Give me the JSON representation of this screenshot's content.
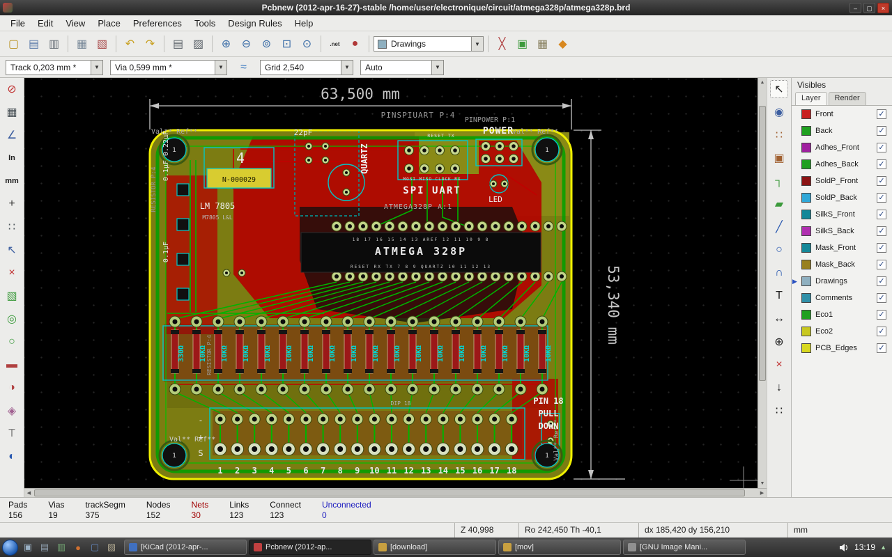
{
  "window": {
    "title": "Pcbnew (2012-apr-16-27)-stable /home/user/electronique/circuit/atmega328p/atmega328p.brd",
    "minimize": "–",
    "maximize": "▢",
    "close": "×"
  },
  "menubar": {
    "items": [
      "File",
      "Edit",
      "View",
      "Place",
      "Preferences",
      "Tools",
      "Design Rules",
      "Help"
    ]
  },
  "toolbar_main": {
    "icons_left": [
      {
        "name": "new-board-icon",
        "glyph": "▢",
        "color": "#b89020"
      },
      {
        "name": "open-board-icon",
        "glyph": "▤",
        "color": "#5878a8"
      },
      {
        "name": "save-board-icon",
        "glyph": "▥",
        "color": "#687078"
      },
      {
        "name": "page-settings-icon",
        "glyph": "▦",
        "color": "#788898"
      },
      {
        "name": "print-preview-icon",
        "glyph": "▧",
        "color": "#a84848"
      },
      {
        "name": "undo-icon",
        "glyph": "↶",
        "color": "#c8a020"
      },
      {
        "name": "redo-icon",
        "glyph": "↷",
        "color": "#c8a020"
      },
      {
        "name": "print-icon",
        "glyph": "▤",
        "color": "#585f66"
      },
      {
        "name": "plot-icon",
        "glyph": "▨",
        "color": "#585f66"
      },
      {
        "name": "zoom-in-icon",
        "glyph": "⊕",
        "color": "#3c6ea8"
      },
      {
        "name": "zoom-out-icon",
        "glyph": "⊖",
        "color": "#3c6ea8"
      },
      {
        "name": "zoom-redraw-icon",
        "glyph": "⊚",
        "color": "#3c6ea8"
      },
      {
        "name": "zoom-fit-icon",
        "glyph": "⊡",
        "color": "#3c6ea8"
      },
      {
        "name": "find-icon",
        "glyph": "⊙",
        "color": "#3c6ea8"
      },
      {
        "name": "netlist-icon",
        "glyph": ".net",
        "color": "#303030"
      },
      {
        "name": "drc-check-icon",
        "glyph": "●",
        "color": "#b03838"
      }
    ],
    "layer_combo": {
      "value": "Drawings",
      "swatch": "#8fb0c0",
      "arrow": "▼"
    },
    "icons_right": [
      {
        "name": "microwave-tools-icon",
        "glyph": "╳",
        "color": "#b04040"
      },
      {
        "name": "module-mode-icon",
        "glyph": "▣",
        "color": "#3c9a3c"
      },
      {
        "name": "ratsnest-mode-icon",
        "glyph": "▦",
        "color": "#888060"
      },
      {
        "name": "freeroute-icon",
        "glyph": "◆",
        "color": "#d88820"
      }
    ]
  },
  "toolbar_options": {
    "track": {
      "value": "Track 0,203 mm *",
      "arrow": "▼"
    },
    "via": {
      "value": "Via 0,599 mm *",
      "arrow": "▼"
    },
    "width_icon": {
      "name": "auto-track-width-icon",
      "glyph": "≈",
      "color": "#3878c0"
    },
    "grid": {
      "value": "Grid 2,540",
      "arrow": "▼"
    },
    "zoom": {
      "value": "Auto",
      "arrow": "▼"
    }
  },
  "left_toolbar": {
    "icons": [
      {
        "name": "drc-off-icon",
        "glyph": "⊘",
        "color": "#c03030"
      },
      {
        "name": "grid-visibility-icon",
        "glyph": "▦",
        "color": "#4a5258"
      },
      {
        "name": "polar-coords-icon",
        "glyph": "∠",
        "color": "#3c5ea0"
      },
      {
        "name": "units-inch-icon",
        "glyph": "In",
        "color": "#202020"
      },
      {
        "name": "units-mm-icon",
        "glyph": "mm",
        "color": "#202020"
      },
      {
        "name": "cursor-shape-icon",
        "glyph": "+",
        "color": "#303030"
      },
      {
        "name": "ratsnest-general-icon",
        "glyph": "∷",
        "color": "#4a5258"
      },
      {
        "name": "ratsnest-module-icon",
        "glyph": "↖",
        "color": "#3c5ea0"
      },
      {
        "name": "autodel-track-icon",
        "glyph": "×",
        "color": "#c03030"
      },
      {
        "name": "show-zones-icon",
        "glyph": "▧",
        "color": "#3c9a3c"
      },
      {
        "name": "sketch-pads-icon",
        "glyph": "◎",
        "color": "#3c9a3c"
      },
      {
        "name": "sketch-vias-icon",
        "glyph": "○",
        "color": "#3c9a3c"
      },
      {
        "name": "sketch-tracks-icon",
        "glyph": "▬",
        "color": "#b04040"
      },
      {
        "name": "high-contrast-icon",
        "glyph": "◑",
        "color": "#b04040"
      },
      {
        "name": "palette-icon",
        "glyph": "◈",
        "color": "#a06090"
      },
      {
        "name": "invisible-text-icon",
        "glyph": "T",
        "color": "#808080"
      },
      {
        "name": "contrast-display-icon",
        "glyph": "◐",
        "color": "#2858b0"
      }
    ]
  },
  "right_toolbar": {
    "icons": [
      {
        "name": "select-tool-icon",
        "glyph": "↖",
        "color": "#202020",
        "active": true
      },
      {
        "name": "highlight-net-icon",
        "glyph": "◉",
        "color": "#3c5ea0"
      },
      {
        "name": "local-ratsnest-icon",
        "glyph": "∷",
        "color": "#a06030"
      },
      {
        "name": "add-module-icon",
        "glyph": "▣",
        "color": "#a06030"
      },
      {
        "name": "add-track-icon",
        "glyph": "┐",
        "color": "#3c9a3c"
      },
      {
        "name": "add-zone-icon",
        "glyph": "▰",
        "color": "#3c9a3c"
      },
      {
        "name": "add-line-icon",
        "glyph": "╱",
        "color": "#2858b0"
      },
      {
        "name": "add-circle-icon",
        "glyph": "○",
        "color": "#2858b0"
      },
      {
        "name": "add-arc-icon",
        "glyph": "∩",
        "color": "#2858b0"
      },
      {
        "name": "add-text-icon",
        "glyph": "T",
        "color": "#202020"
      },
      {
        "name": "add-dimension-icon",
        "glyph": "↔",
        "color": "#202020"
      },
      {
        "name": "add-target-icon",
        "glyph": "⊕",
        "color": "#202020"
      },
      {
        "name": "delete-tool-icon",
        "glyph": "×",
        "color": "#c03030"
      },
      {
        "name": "offset-origin-icon",
        "glyph": "↓",
        "color": "#202020"
      },
      {
        "name": "grid-origin-icon",
        "glyph": "∷",
        "color": "#202020"
      }
    ]
  },
  "visibles": {
    "title": "Visibles",
    "tabs": [
      {
        "label": "Layer",
        "active": true
      },
      {
        "label": "Render",
        "active": false
      }
    ],
    "check_glyph": "✓",
    "current_arrow": "▶",
    "layers": [
      {
        "name": "Front",
        "color": "#c82020",
        "checked": true,
        "current": false
      },
      {
        "name": "Back",
        "color": "#20a020",
        "checked": true,
        "current": false
      },
      {
        "name": "Adhes_Front",
        "color": "#a020a0",
        "checked": true,
        "current": false
      },
      {
        "name": "Adhes_Back",
        "color": "#20a020",
        "checked": true,
        "current": false
      },
      {
        "name": "SoldP_Front",
        "color": "#8c1414",
        "checked": true,
        "current": false
      },
      {
        "name": "SoldP_Back",
        "color": "#30a8d8",
        "checked": true,
        "current": false
      },
      {
        "name": "SilkS_Front",
        "color": "#148898",
        "checked": true,
        "current": false
      },
      {
        "name": "SilkS_Back",
        "color": "#b030b0",
        "checked": true,
        "current": false
      },
      {
        "name": "Mask_Front",
        "color": "#148898",
        "checked": true,
        "current": false
      },
      {
        "name": "Mask_Back",
        "color": "#988020",
        "checked": true,
        "current": false
      },
      {
        "name": "Drawings",
        "color": "#8fb0c0",
        "checked": true,
        "current": true
      },
      {
        "name": "Comments",
        "color": "#3090a8",
        "checked": true,
        "current": false
      },
      {
        "name": "Eco1",
        "color": "#20a020",
        "checked": true,
        "current": false
      },
      {
        "name": "Eco2",
        "color": "#c8c820",
        "checked": true,
        "current": false
      },
      {
        "name": "PCB_Edges",
        "color": "#d8d820",
        "checked": true,
        "current": false
      }
    ]
  },
  "statusbar": {
    "fields": [
      {
        "label": "Pads",
        "value": "156",
        "color": "#101010"
      },
      {
        "label": "Vias",
        "value": "19",
        "color": "#101010"
      },
      {
        "label": "trackSegm",
        "value": "375",
        "color": "#101010"
      },
      {
        "label": "Nodes",
        "value": "152",
        "color": "#101010"
      },
      {
        "label": "Nets",
        "value": "30",
        "color": "#a00000"
      },
      {
        "label": "Links",
        "value": "123",
        "color": "#101010"
      },
      {
        "label": "Connect",
        "value": "123",
        "color": "#101010"
      },
      {
        "label": "Unconnected",
        "value": "0",
        "color": "#2020c0"
      }
    ],
    "coords": {
      "z": "Z 40,998",
      "ro": "Ro 242,450 Th -40,1",
      "dxdy": "dx 185,420  dy 156,210",
      "units": "mm"
    }
  },
  "taskbar": {
    "launchers": [
      {
        "name": "show-desktop-icon",
        "glyph": "▣",
        "color": "#9ab0c4"
      },
      {
        "name": "file-manager-icon",
        "glyph": "▤",
        "color": "#90a0b0"
      },
      {
        "name": "terminal-icon",
        "glyph": "▥",
        "color": "#74a874"
      },
      {
        "name": "browser-icon",
        "glyph": "●",
        "color": "#d07030"
      },
      {
        "name": "editor-icon",
        "glyph": "▢",
        "color": "#6488c0"
      },
      {
        "name": "viewer-icon",
        "glyph": "▧",
        "color": "#b0a890"
      }
    ],
    "windows": [
      {
        "label": "[KiCad (2012-apr-...",
        "icon_color": "#4070c0",
        "active": false
      },
      {
        "label": "Pcbnew (2012-ap...",
        "icon_color": "#c04040",
        "active": true
      },
      {
        "label": "[download]",
        "icon_color": "#c8a040",
        "active": false
      },
      {
        "label": "[mov]",
        "icon_color": "#c8a040",
        "active": false
      },
      {
        "label": "[GNU Image Mani...",
        "icon_color": "#909090",
        "active": false
      }
    ],
    "clock": "13:19",
    "tray_arrow": "▲"
  },
  "pcb": {
    "dim_width": "63,500 mm",
    "dim_height": "53,340 mm",
    "texts": {
      "pinspiuart": "PINSPIUART P:4",
      "pinpower": "PINPOWER P:1",
      "val_ref_tl": "Val** Ref**",
      "val_ref_tr": "Val** Ref**",
      "val_ref_bl": "Val** Ref**",
      "val_ref_br": "Val** Ref**",
      "resistor_p4": "RESISTOR P:4",
      "cap_22pf": "22pF",
      "caps_01_022": "0.1µF 0.22µF",
      "cap_01uf": "0.1µF",
      "quartz": "QUARTZ",
      "spi_uart": "SPI UART",
      "spi_signals": "MOSI MISO CLOCK RX",
      "reset_tx": "RESET TX",
      "power": "POWER",
      "led": "LED",
      "reg_name": "LM 7805",
      "reg_sub": "M7805 L&L",
      "part_no": "N-000029",
      "big4": "4",
      "mcu": "ATMEGA 328P",
      "mcu_ref": "ATMEGA328P A:1",
      "chip_top_pins": "18 17 16 15 14 13 AREF 12 11 10 9 8",
      "chip_bottom_pins": "RESET RX TX 7 8 9 QUARTZ 10 11 12 13",
      "pin18_line1": "PIN 18",
      "pin18_line2": "PULL",
      "pin18_line3": "DOWN",
      "dip": "DIP 18",
      "hole": "1",
      "minus": "-",
      "plus": "+",
      "sign_s": "S"
    },
    "resistor_labels": [
      "330Ω",
      "10KΩ",
      "10KΩ",
      "10KΩ",
      "10KΩ",
      "10KΩ",
      "10KΩ",
      "10KΩ",
      "10KΩ",
      "10KΩ",
      "10KΩ",
      "10KΩ",
      "10KΩ",
      "10KΩ",
      "10KΩ",
      "10KΩ",
      "10KΩ",
      "10KΩ"
    ],
    "pin_numbers": [
      "1",
      "2",
      "3",
      "4",
      "5",
      "6",
      "7",
      "8",
      "9",
      "10",
      "11",
      "12",
      "13",
      "14",
      "15",
      "16",
      "17",
      "18"
    ]
  }
}
